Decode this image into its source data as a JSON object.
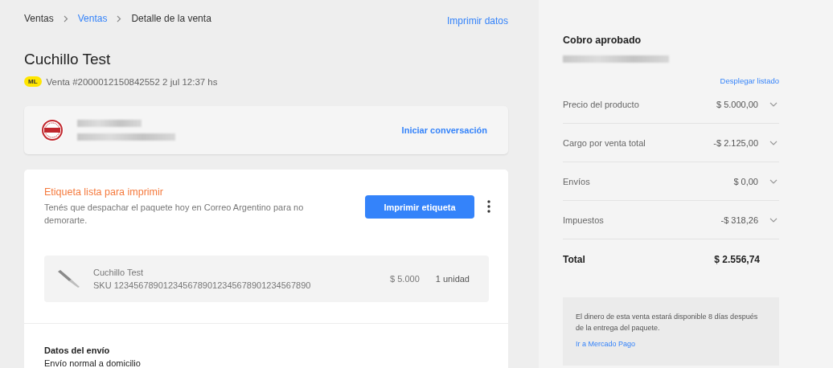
{
  "breadcrumb": [
    {
      "label": "Ventas",
      "link": false
    },
    {
      "label": "Ventas",
      "link": true
    },
    {
      "label": "Detalle de la venta",
      "link": false
    }
  ],
  "print_data_link": "Imprimir datos",
  "title": "Cuchillo Test",
  "sale_meta": {
    "badge": "ML",
    "text": "Venta #2000012150842552 2 jul 12:37 hs"
  },
  "buyer_card": {
    "action": "Iniciar conversación"
  },
  "shipment_card": {
    "status": "Etiqueta lista para imprimir",
    "message": "Tenés que despachar el paquete hoy en Correo Argentino para no demorarte.",
    "button": "Imprimir etiqueta",
    "item": {
      "name": "Cuchillo Test",
      "sku": "SKU 1234567890123456789012345678901234567890",
      "price": "$ 5.000",
      "quantity": "1 unidad"
    },
    "shipping_title": "Datos del envío",
    "shipping_method": "Envío normal a domicilio"
  },
  "payment": {
    "title": "Cobro aprobado",
    "expand_link": "Desplegar listado",
    "rows": [
      {
        "label": "Precio del producto",
        "amount": "$ 5.000,00"
      },
      {
        "label": "Cargo por venta total",
        "amount": "-$ 2.125,00"
      },
      {
        "label": "Envíos",
        "amount": "$ 0,00"
      },
      {
        "label": "Impuestos",
        "amount": "-$ 318,26"
      }
    ],
    "total_label": "Total",
    "total_amount": "$ 2.556,74",
    "info": "El dinero de esta venta estará disponible 8 días después de la entrega del paquete.",
    "info_link": "Ir a Mercado Pago"
  }
}
